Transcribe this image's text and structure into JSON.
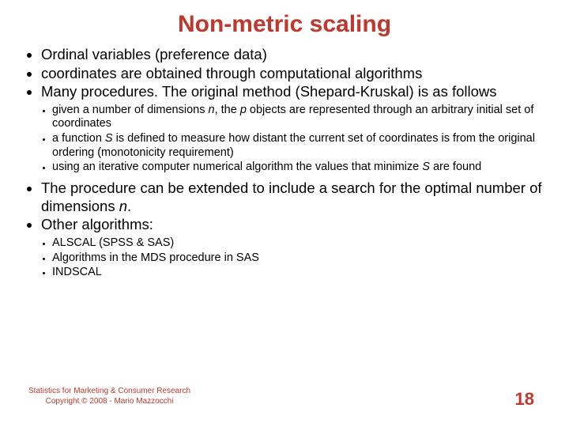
{
  "title": "Non-metric scaling",
  "accent_color": "#c0372d",
  "bullets1a": [
    "Ordinal variables (preference data)",
    "coordinates are obtained through computational algorithms",
    "Many procedures. The original method (Shepard-Kruskal) is as follows"
  ],
  "bullets2a": {
    "i0_pre": "given a number of dimensions ",
    "i0_n": "n",
    "i0_mid": ", the ",
    "i0_p": "p",
    "i0_post": " objects are represented through an arbitrary initial set of coordinates",
    "i1_pre": "a function ",
    "i1_S": "S",
    "i1_post": " is defined to measure how distant the current set of coordinates is from the original ordering (monotonicity requirement)",
    "i2_pre": "using an iterative computer numerical algorithm the values that minimize ",
    "i2_S": "S",
    "i2_post": " are found"
  },
  "bullets1b": {
    "i0_pre": "The procedure can be extended to include a search for the optimal number of dimensions ",
    "i0_n": "n",
    "i0_post": ".",
    "i1": "Other algorithms:"
  },
  "bullets2b": [
    "ALSCAL (SPSS & SAS)",
    "Algorithms in the MDS procedure in SAS",
    "INDSCAL"
  ],
  "footer": {
    "line1": "Statistics for Marketing & Consumer Research",
    "line2": "Copyright © 2008 - Mario Mazzocchi"
  },
  "page_number": "18"
}
